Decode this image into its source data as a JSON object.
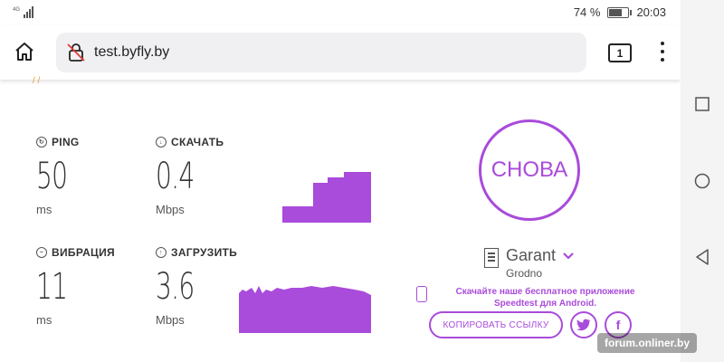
{
  "status": {
    "network": "4G",
    "battery": "74 %",
    "battery_level": 0.74,
    "time": "20:03"
  },
  "browser": {
    "url": "test.byfly.by",
    "tab_count": "1"
  },
  "partial_text": "/ /",
  "metrics": {
    "ping": {
      "label": "PING",
      "value": "50",
      "unit": "ms"
    },
    "download": {
      "label": "СКАЧАТЬ",
      "value": "0.4",
      "unit": "Mbps"
    },
    "jitter": {
      "label": "ВИБРАЦИЯ",
      "value": "11",
      "unit": "ms"
    },
    "upload": {
      "label": "ЗАГРУЗИТЬ",
      "value": "3.6",
      "unit": "Mbps"
    }
  },
  "again_button": "СНОВА",
  "server": {
    "name": "Garant",
    "city": "Grodno"
  },
  "promo": "Скачайте наше бесплатное приложение Speedtest для Android.",
  "copy_link": "КОПИРОВАТЬ ССЫЛКУ",
  "watermark": "forum.onliner.by",
  "colors": {
    "accent": "#a94bdb",
    "graph": "#a94bdb"
  },
  "icons": {
    "home": "home-icon",
    "lock": "lock-icon",
    "menu": "more-vert-icon",
    "nav_square": "recents-icon",
    "nav_circle": "home-nav-icon",
    "nav_back": "back-icon",
    "twitter": "twitter-icon",
    "facebook": "facebook-icon"
  }
}
